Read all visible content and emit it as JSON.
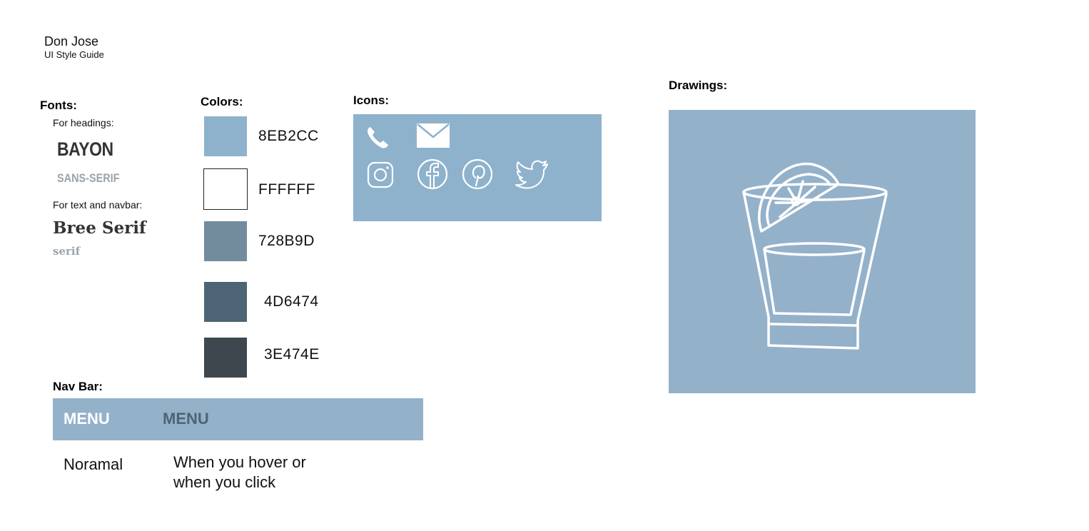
{
  "header": {
    "title": "Don Jose",
    "subtitle": "UI Style Guide"
  },
  "fonts": {
    "heading": "Fonts:",
    "for_headings": "For headings:",
    "heading_font": "BAYON",
    "heading_family": "SANS-SERIF",
    "for_text": "For text and navbar:",
    "text_font": "Bree Serif",
    "text_family": "serif"
  },
  "colors": {
    "heading": "Colors:",
    "swatches": [
      {
        "code": "8EB2CC",
        "hex": "#8EB2CC"
      },
      {
        "code": "FFFFFF",
        "hex": "#FFFFFF"
      },
      {
        "code": "728B9D",
        "hex": "#728B9D"
      },
      {
        "code": "4D6474",
        "hex": "#4D6474"
      },
      {
        "code": "3E474E",
        "hex": "#3E474E"
      }
    ]
  },
  "icons": {
    "heading": "Icons:",
    "items": [
      "phone-icon",
      "mail-icon",
      "instagram-icon",
      "facebook-icon",
      "pinterest-icon",
      "twitter-icon"
    ]
  },
  "drawings": {
    "heading": "Drawings:",
    "item": "tequila-glass-with-lime"
  },
  "navbar": {
    "heading": "Nav Bar:",
    "normal_label": "MENU",
    "hover_label": "MENU",
    "normal_caption": "Noramal",
    "hover_caption_line1": "When you hover or",
    "hover_caption_line2": "when you click",
    "normal_color": "#FFFFFF",
    "hover_color": "#4D6474"
  }
}
